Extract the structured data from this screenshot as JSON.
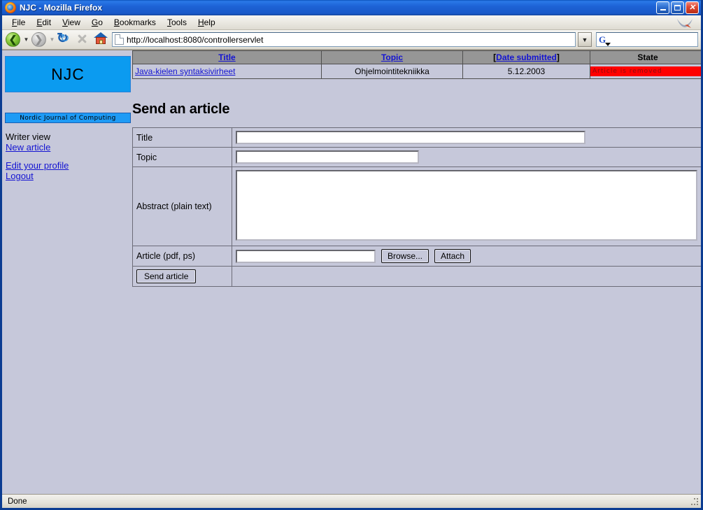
{
  "window": {
    "title": "NJC - Mozilla Firefox",
    "controls": {
      "minimize": "minimize",
      "maximize": "maximize",
      "close": "close"
    }
  },
  "menu": {
    "items": [
      "File",
      "Edit",
      "View",
      "Go",
      "Bookmarks",
      "Tools",
      "Help"
    ]
  },
  "toolbar": {
    "back": "Back",
    "forward": "Forward",
    "reload": "Reload",
    "stop": "Stop",
    "home": "Home",
    "url": "http://localhost:8080/controllerservlet",
    "search_placeholder": ""
  },
  "sidebar": {
    "logo": "NJC",
    "banner": "Nordic Journal of Computing",
    "role_label": "Writer view",
    "links": [
      {
        "label": "New article"
      },
      {
        "label": "Edit your profile"
      },
      {
        "label": "Logout"
      }
    ]
  },
  "articles_table": {
    "headers": [
      {
        "text": "Title",
        "link": true,
        "bracketed": false
      },
      {
        "text": "Topic",
        "link": true,
        "bracketed": false
      },
      {
        "text": "Date submitted",
        "link": true,
        "bracketed": true
      },
      {
        "text": "State",
        "link": false,
        "bracketed": false
      }
    ],
    "rows": [
      {
        "title": "Java-kielen syntaksivirheet",
        "topic": "Ohjelmointitekniikka",
        "date": "5.12.2003",
        "state": "Article is removed"
      }
    ]
  },
  "form": {
    "heading": "Send an article",
    "fields": {
      "title_label": "Title",
      "title_value": "",
      "topic_label": "Topic",
      "topic_value": "",
      "abstract_label": "Abstract (plain text)",
      "abstract_value": "",
      "article_label": "Article (pdf, ps)",
      "article_value": ""
    },
    "buttons": {
      "browse": "Browse...",
      "attach": "Attach",
      "send": "Send article"
    }
  },
  "statusbar": {
    "text": "Done"
  },
  "colors": {
    "page_bg": "#c6c8da",
    "accent_blue": "#0b9bf0",
    "link": "#1414d2",
    "state_removed_bg": "#ff0000",
    "state_removed_fg": "#8a0d0d",
    "table_header_bg": "#969696"
  }
}
